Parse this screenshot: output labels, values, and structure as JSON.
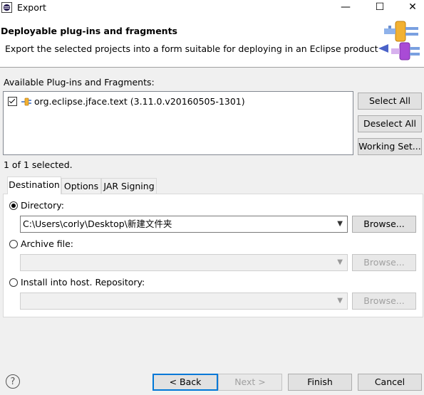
{
  "window": {
    "title": "Export",
    "minimize": "—",
    "maximize": "☐",
    "close": "✕"
  },
  "header": {
    "title": "Deployable plug-ins and fragments",
    "description": "Export the selected projects into a form suitable for deploying in an Eclipse product"
  },
  "available": {
    "label": "Available Plug-ins and Fragments:",
    "items": [
      {
        "label": "org.eclipse.jface.text (3.11.0.v20160505-1301)",
        "checked": true
      }
    ],
    "selection_status": "1 of 1 selected."
  },
  "side_buttons": {
    "select_all": "Select All",
    "deselect_all": "Deselect All",
    "working_set": "Working Set..."
  },
  "tabs": [
    {
      "label": "Destination",
      "active": true
    },
    {
      "label": "Options"
    },
    {
      "label": "JAR Signing"
    }
  ],
  "destination": {
    "directory_label": "Directory:",
    "directory_value": "C:\\Users\\corly\\Desktop\\新建文件夹",
    "archive_label": "Archive file:",
    "archive_value": "",
    "install_label": "Install into host. Repository:",
    "install_value": "",
    "browse": "Browse..."
  },
  "footer": {
    "help": "?",
    "back": "< Back",
    "next": "Next >",
    "finish": "Finish",
    "cancel": "Cancel"
  },
  "colors": {
    "accent": "#0078d7",
    "background": "#f0f0f0"
  }
}
